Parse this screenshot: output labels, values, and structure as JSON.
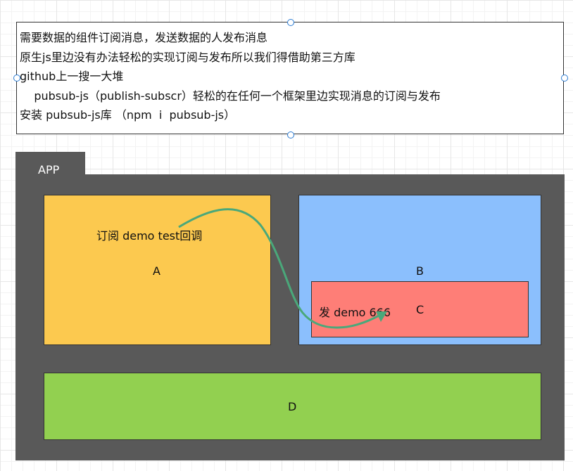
{
  "note": {
    "lines": [
      "需要数据的组件订阅消息，发送数据的人发布消息",
      "原生js里边没有办法轻松的实现订阅与发布所以我们得借助第三方库",
      "github上一搜一大堆",
      "    pubsub-js（publish-subscr）轻松的在任何一个框架里边实现消息的订阅与发布",
      "安装 pubsub-js库 （npm  i  pubsub-js）"
    ]
  },
  "app": {
    "label": "APP",
    "color": "#595959"
  },
  "components": {
    "a": {
      "label": "A",
      "note": "订阅 demo test回调",
      "color": "#fcc94f"
    },
    "b": {
      "label": "B",
      "color": "#8bbffd"
    },
    "c": {
      "label": "C",
      "note": "发 demo 666",
      "color": "#fe7e77"
    },
    "d": {
      "label": "D",
      "color": "#92d050"
    }
  },
  "arrow_color": "#4aa87a"
}
